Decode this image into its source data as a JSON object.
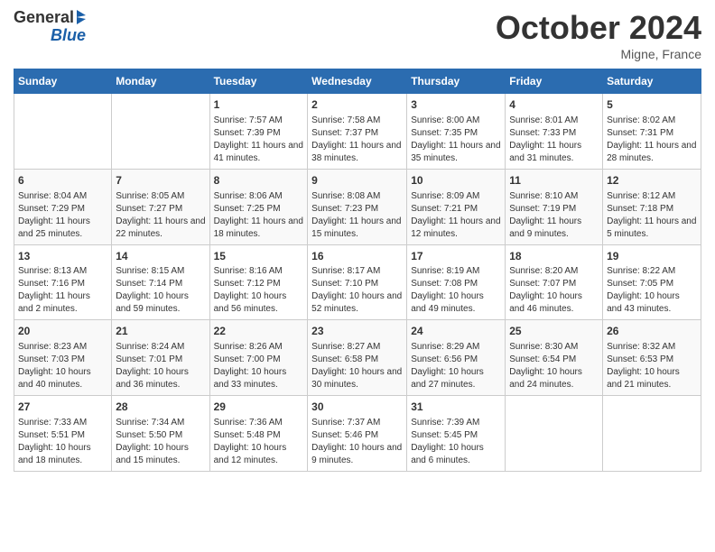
{
  "logo": {
    "line1": "General",
    "line2": "Blue"
  },
  "header": {
    "month": "October 2024",
    "location": "Migne, France"
  },
  "days_of_week": [
    "Sunday",
    "Monday",
    "Tuesday",
    "Wednesday",
    "Thursday",
    "Friday",
    "Saturday"
  ],
  "weeks": [
    [
      {
        "day": "",
        "info": ""
      },
      {
        "day": "",
        "info": ""
      },
      {
        "day": "1",
        "info": "Sunrise: 7:57 AM\nSunset: 7:39 PM\nDaylight: 11 hours and 41 minutes."
      },
      {
        "day": "2",
        "info": "Sunrise: 7:58 AM\nSunset: 7:37 PM\nDaylight: 11 hours and 38 minutes."
      },
      {
        "day": "3",
        "info": "Sunrise: 8:00 AM\nSunset: 7:35 PM\nDaylight: 11 hours and 35 minutes."
      },
      {
        "day": "4",
        "info": "Sunrise: 8:01 AM\nSunset: 7:33 PM\nDaylight: 11 hours and 31 minutes."
      },
      {
        "day": "5",
        "info": "Sunrise: 8:02 AM\nSunset: 7:31 PM\nDaylight: 11 hours and 28 minutes."
      }
    ],
    [
      {
        "day": "6",
        "info": "Sunrise: 8:04 AM\nSunset: 7:29 PM\nDaylight: 11 hours and 25 minutes."
      },
      {
        "day": "7",
        "info": "Sunrise: 8:05 AM\nSunset: 7:27 PM\nDaylight: 11 hours and 22 minutes."
      },
      {
        "day": "8",
        "info": "Sunrise: 8:06 AM\nSunset: 7:25 PM\nDaylight: 11 hours and 18 minutes."
      },
      {
        "day": "9",
        "info": "Sunrise: 8:08 AM\nSunset: 7:23 PM\nDaylight: 11 hours and 15 minutes."
      },
      {
        "day": "10",
        "info": "Sunrise: 8:09 AM\nSunset: 7:21 PM\nDaylight: 11 hours and 12 minutes."
      },
      {
        "day": "11",
        "info": "Sunrise: 8:10 AM\nSunset: 7:19 PM\nDaylight: 11 hours and 9 minutes."
      },
      {
        "day": "12",
        "info": "Sunrise: 8:12 AM\nSunset: 7:18 PM\nDaylight: 11 hours and 5 minutes."
      }
    ],
    [
      {
        "day": "13",
        "info": "Sunrise: 8:13 AM\nSunset: 7:16 PM\nDaylight: 11 hours and 2 minutes."
      },
      {
        "day": "14",
        "info": "Sunrise: 8:15 AM\nSunset: 7:14 PM\nDaylight: 10 hours and 59 minutes."
      },
      {
        "day": "15",
        "info": "Sunrise: 8:16 AM\nSunset: 7:12 PM\nDaylight: 10 hours and 56 minutes."
      },
      {
        "day": "16",
        "info": "Sunrise: 8:17 AM\nSunset: 7:10 PM\nDaylight: 10 hours and 52 minutes."
      },
      {
        "day": "17",
        "info": "Sunrise: 8:19 AM\nSunset: 7:08 PM\nDaylight: 10 hours and 49 minutes."
      },
      {
        "day": "18",
        "info": "Sunrise: 8:20 AM\nSunset: 7:07 PM\nDaylight: 10 hours and 46 minutes."
      },
      {
        "day": "19",
        "info": "Sunrise: 8:22 AM\nSunset: 7:05 PM\nDaylight: 10 hours and 43 minutes."
      }
    ],
    [
      {
        "day": "20",
        "info": "Sunrise: 8:23 AM\nSunset: 7:03 PM\nDaylight: 10 hours and 40 minutes."
      },
      {
        "day": "21",
        "info": "Sunrise: 8:24 AM\nSunset: 7:01 PM\nDaylight: 10 hours and 36 minutes."
      },
      {
        "day": "22",
        "info": "Sunrise: 8:26 AM\nSunset: 7:00 PM\nDaylight: 10 hours and 33 minutes."
      },
      {
        "day": "23",
        "info": "Sunrise: 8:27 AM\nSunset: 6:58 PM\nDaylight: 10 hours and 30 minutes."
      },
      {
        "day": "24",
        "info": "Sunrise: 8:29 AM\nSunset: 6:56 PM\nDaylight: 10 hours and 27 minutes."
      },
      {
        "day": "25",
        "info": "Sunrise: 8:30 AM\nSunset: 6:54 PM\nDaylight: 10 hours and 24 minutes."
      },
      {
        "day": "26",
        "info": "Sunrise: 8:32 AM\nSunset: 6:53 PM\nDaylight: 10 hours and 21 minutes."
      }
    ],
    [
      {
        "day": "27",
        "info": "Sunrise: 7:33 AM\nSunset: 5:51 PM\nDaylight: 10 hours and 18 minutes."
      },
      {
        "day": "28",
        "info": "Sunrise: 7:34 AM\nSunset: 5:50 PM\nDaylight: 10 hours and 15 minutes."
      },
      {
        "day": "29",
        "info": "Sunrise: 7:36 AM\nSunset: 5:48 PM\nDaylight: 10 hours and 12 minutes."
      },
      {
        "day": "30",
        "info": "Sunrise: 7:37 AM\nSunset: 5:46 PM\nDaylight: 10 hours and 9 minutes."
      },
      {
        "day": "31",
        "info": "Sunrise: 7:39 AM\nSunset: 5:45 PM\nDaylight: 10 hours and 6 minutes."
      },
      {
        "day": "",
        "info": ""
      },
      {
        "day": "",
        "info": ""
      }
    ]
  ]
}
